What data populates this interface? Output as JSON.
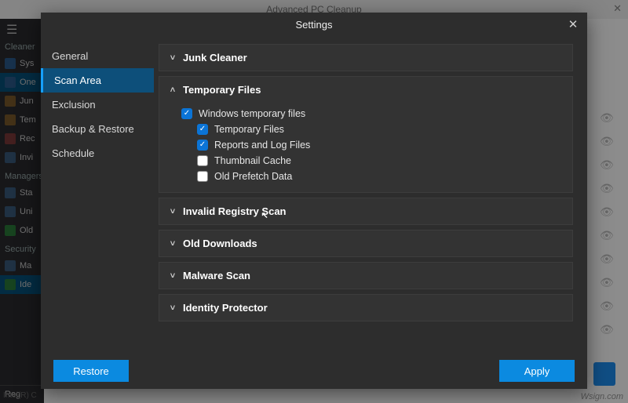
{
  "bg": {
    "title": "Advanced PC Cleanup",
    "sections": {
      "cleaner": "Cleaner",
      "managers": "Managers",
      "security": "Security"
    },
    "cleaner_items": [
      "Sys",
      "One",
      "Jun",
      "Tem",
      "Rec",
      "Invi"
    ],
    "manager_items": [
      "Sta",
      "Uni",
      "Old"
    ],
    "security_items": [
      "Ma",
      "Ide"
    ],
    "status": "Intel(R) C",
    "watermark": "Wsign.com",
    "reg": "Reg"
  },
  "modal": {
    "title": "Settings",
    "nav": [
      "General",
      "Scan Area",
      "Exclusion",
      "Backup & Restore",
      "Schedule"
    ],
    "nav_active_index": 1,
    "sections": [
      {
        "label": "Junk Cleaner",
        "open": false
      },
      {
        "label": "Temporary Files",
        "open": true,
        "items": [
          {
            "label": "Windows temporary files",
            "checked": true,
            "indent": false
          },
          {
            "label": "Temporary Files",
            "checked": true,
            "indent": true
          },
          {
            "label": "Reports and Log Files",
            "checked": true,
            "indent": true
          },
          {
            "label": "Thumbnail Cache",
            "checked": false,
            "indent": true
          },
          {
            "label": "Old Prefetch Data",
            "checked": false,
            "indent": true
          }
        ]
      },
      {
        "label": "Invalid Registry Scan",
        "open": false
      },
      {
        "label": "Old Downloads",
        "open": false
      },
      {
        "label": "Malware Scan",
        "open": false
      },
      {
        "label": "Identity Protector",
        "open": false
      }
    ],
    "buttons": {
      "restore": "Restore",
      "apply": "Apply"
    }
  }
}
